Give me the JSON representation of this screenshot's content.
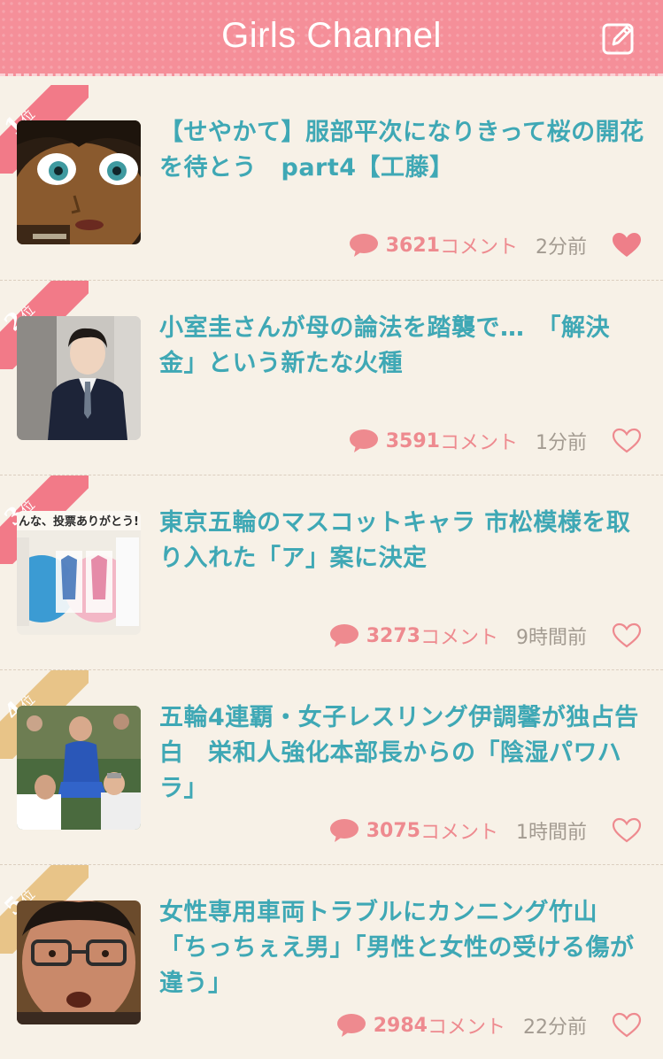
{
  "header": {
    "title": "Girls Channel",
    "edit_icon": "edit-icon"
  },
  "colors": {
    "header_bg": "#f58f99",
    "title_text": "#3fa8b5",
    "count_text": "#ee8a8f",
    "rank_top": "#f27a88",
    "rank_other": "#e8c488",
    "page_bg": "#f7f1e7"
  },
  "items": [
    {
      "rank": "1",
      "rank_suffix": "位",
      "title": "【せやかて】服部平次になりきって桜の開花を待とう　part4【工藤】",
      "count": "3621",
      "count_unit": "コメント",
      "time": "2分前",
      "favorited": true
    },
    {
      "rank": "2",
      "rank_suffix": "位",
      "title": "小室圭さんが母の論法を踏襲で…　「解決金」という新たな火種",
      "count": "3591",
      "count_unit": "コメント",
      "time": "1分前",
      "favorited": false
    },
    {
      "rank": "3",
      "rank_suffix": "位",
      "title": "東京五輪のマスコットキャラ 市松模様を取り入れた「ア」案に決定",
      "count": "3273",
      "count_unit": "コメント",
      "time": "9時間前",
      "favorited": false
    },
    {
      "rank": "4",
      "rank_suffix": "位",
      "title": "五輪4連覇・女子レスリング伊調馨が独占告白　栄和人強化本部長からの「陰湿パワハラ」",
      "count": "3075",
      "count_unit": "コメント",
      "time": "1時間前",
      "favorited": false
    },
    {
      "rank": "5",
      "rank_suffix": "位",
      "title": "女性専用車両トラブルにカンニング竹山「ちっちぇえ男」「男性と女性の受ける傷が違う」",
      "count": "2984",
      "count_unit": "コメント",
      "time": "22分前",
      "favorited": false
    }
  ],
  "thumb_image": {
    "image_text": "んな、投票ありがとう!"
  }
}
